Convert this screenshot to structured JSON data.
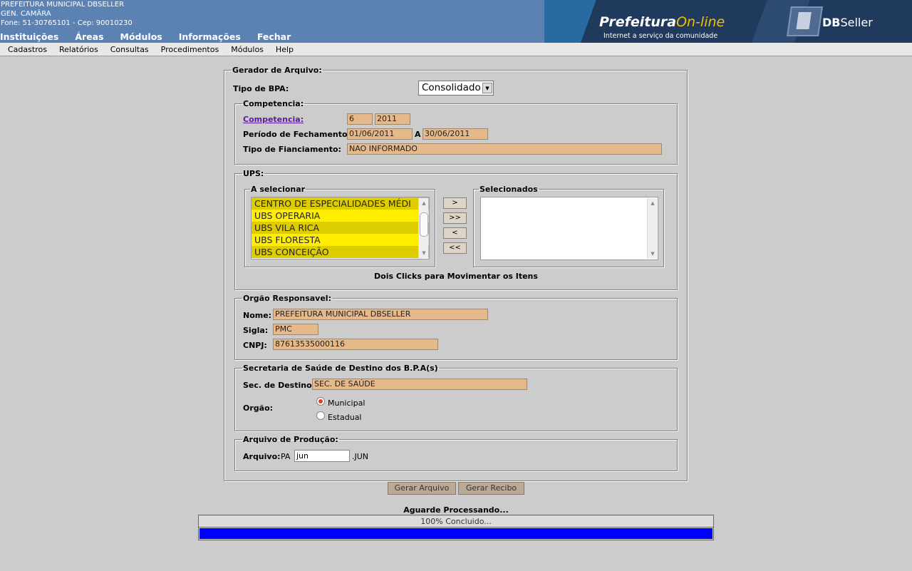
{
  "header": {
    "org_name": "PREFEITURA MUNICIPAL DBSELLER",
    "org_sub": "GEN. CAMÂRA",
    "org_contact": "Fone: 51-30765101  -  Cep: 90010230",
    "nav": [
      "Instituições",
      "Áreas",
      "Módulos",
      "Informações",
      "Fechar"
    ],
    "brand_pref": "Prefeitura",
    "brand_online": "On-line",
    "brand_tagline": "Internet a serviço da comunidade",
    "brand_db": "DB",
    "brand_seller": "Seller"
  },
  "menu": [
    "Cadastros",
    "Relatórios",
    "Consultas",
    "Procedimentos",
    "Módulos",
    "Help"
  ],
  "form": {
    "legend": "Gerador de Arquivo:",
    "tipo_bpa_label": "Tipo de BPA:",
    "tipo_bpa_value": "Consolidado",
    "competencia": {
      "legend": "Competencia:",
      "link": "Competencia:",
      "mes": "6",
      "ano": "2011",
      "periodo_label": "Período de Fechamento :",
      "periodo_ini": "01/06/2011",
      "periodo_sep": "A",
      "periodo_fim": "30/06/2011",
      "financiamento_label": "Tipo de Fianciamento:",
      "financiamento_value": "NAO INFORMADO"
    },
    "ups": {
      "legend": "UPS:",
      "a_selecionar_legend": "A selecionar",
      "items": [
        "CENTRO DE ESPECIALIDADES MÉDI",
        "UBS OPERARIA",
        "UBS VILA RICA",
        "UBS FLORESTA",
        "UBS CONCEIÇÃO"
      ],
      "item_colors": [
        "#ddcc00",
        "#ffee00"
      ],
      "btn_add": ">",
      "btn_add_all": ">>",
      "btn_remove": "<",
      "btn_remove_all": "<<",
      "selecionados_legend": "Selecionados",
      "hint": "Dois Clicks para Movimentar os Itens"
    },
    "orgao": {
      "legend": "Orgão Responsavel:",
      "nome_label": "Nome:",
      "nome_value": "PREFEITURA MUNICIPAL DBSELLER",
      "sigla_label": "Sigla:",
      "sigla_value": "PMC",
      "cnpj_label": "CNPJ:",
      "cnpj_value": "87613535000116"
    },
    "secretaria": {
      "legend": "Secretaria de Saúde de Destino dos B.P.A(s)",
      "destino_label": "Sec. de Destino:",
      "destino_value": "SEC. DE SAÚDE",
      "orgao_label": "Orgão:",
      "opt_municipal": "Municipal",
      "opt_estadual": "Estadual",
      "selected": "Municipal"
    },
    "arquivo": {
      "legend": "Arquivo de Produção:",
      "label": "Arquivo:",
      "prefix": "PA",
      "value": "jun",
      "suffix": ".JUN"
    },
    "btn_gerar_arquivo": "Gerar Arquivo",
    "btn_gerar_recibo": "Gerar Recibo"
  },
  "progress": {
    "status": "Aguarde Processando...",
    "text": "100% Concluido...",
    "fraction": 1.0,
    "color": "#0000ff"
  }
}
